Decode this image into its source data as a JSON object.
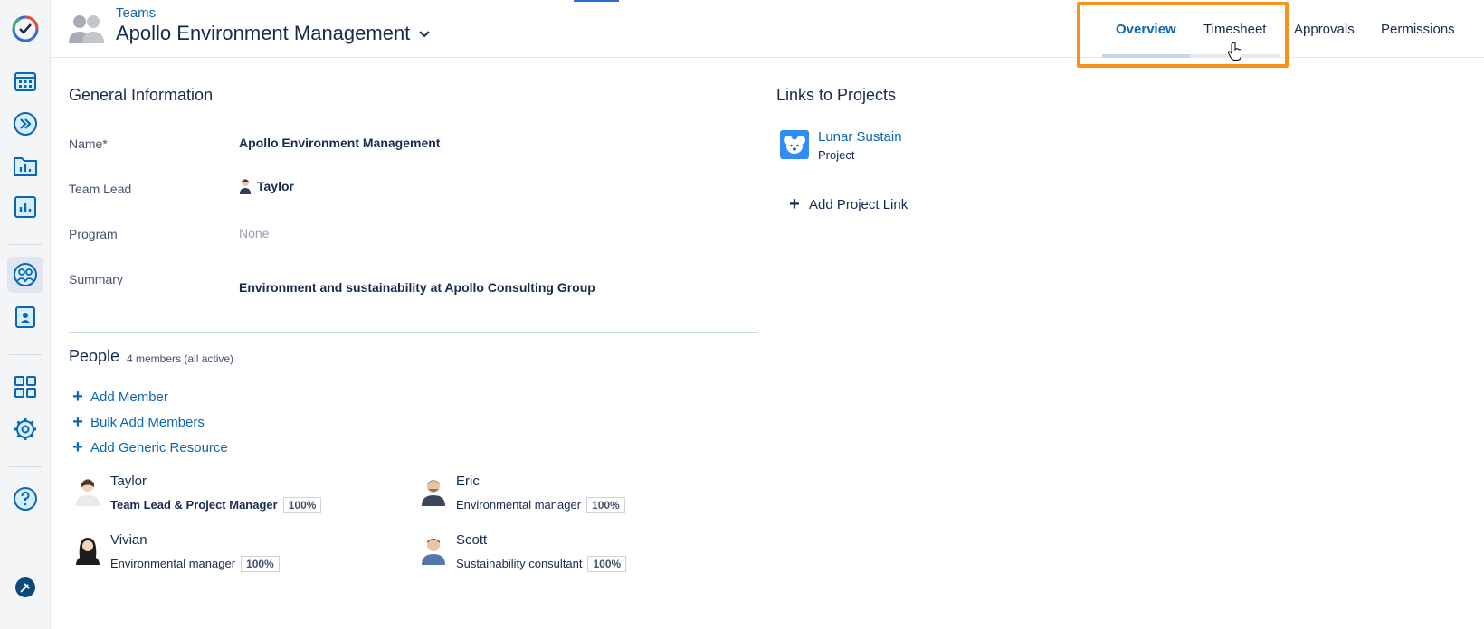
{
  "sidebar": {
    "icons": [
      "logo-check-icon",
      "calendar-icon",
      "fast-forward-icon",
      "folder-chart-icon",
      "bar-chart-icon",
      "teams-icon",
      "person-card-icon",
      "apps-grid-icon",
      "gear-icon",
      "help-icon",
      "pin-icon"
    ]
  },
  "header": {
    "breadcrumb": "Teams",
    "title": "Apollo Environment Management",
    "tabs": [
      {
        "label": "Overview",
        "active": true
      },
      {
        "label": "Timesheet",
        "active": false
      },
      {
        "label": "Approvals",
        "active": false
      },
      {
        "label": "Permissions",
        "active": false
      }
    ]
  },
  "general": {
    "title": "General Information",
    "fields": [
      {
        "label": "Name*",
        "value": "Apollo Environment Management"
      },
      {
        "label": "Team Lead",
        "value": "Taylor"
      },
      {
        "label": "Program",
        "value": "None"
      },
      {
        "label": "Summary",
        "value": "Environment and sustainability at Apollo Consulting Group"
      }
    ]
  },
  "people": {
    "title": "People",
    "count": "4 members (all active)",
    "actions": [
      "Add Member",
      "Bulk Add Members",
      "Add Generic Resource"
    ],
    "members": [
      {
        "name": "Taylor",
        "role": "Team Lead & Project Manager",
        "allocation": "100%"
      },
      {
        "name": "Eric",
        "role": "Environmental manager",
        "allocation": "100%"
      },
      {
        "name": "Vivian",
        "role": "Environmental manager",
        "allocation": "100%"
      },
      {
        "name": "Scott",
        "role": "Sustainability consultant",
        "allocation": "100%"
      }
    ]
  },
  "links": {
    "title": "Links to Projects",
    "project_name": "Lunar Sustain",
    "project_type": "Project",
    "add_label": "Add Project Link"
  },
  "colors": {
    "accent": "#0b66b3",
    "highlight": "#f7921e"
  }
}
